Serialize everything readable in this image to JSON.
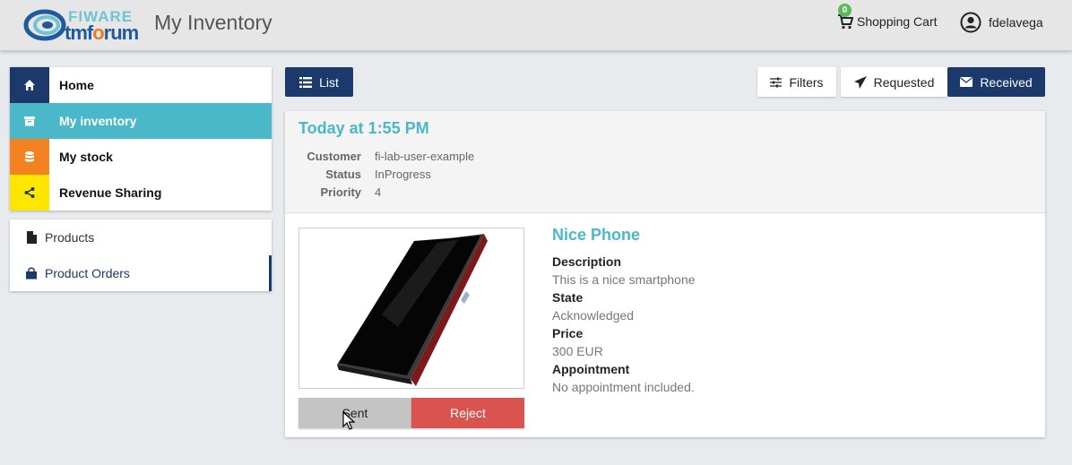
{
  "header": {
    "logo_top": "FIWARE",
    "logo_bottom_tm": "tm",
    "logo_bottom_f": "f",
    "logo_bottom_rest": "rum",
    "title": "My Inventory",
    "cart_label": "Shopping Cart",
    "cart_count": "0",
    "username": "fdelavega"
  },
  "sidebar": {
    "main": [
      {
        "label": "Home",
        "icon": "home-icon",
        "color": "#1b3a6b"
      },
      {
        "label": "My inventory",
        "icon": "archive-icon",
        "color": "#4ab8c8"
      },
      {
        "label": "My stock",
        "icon": "database-icon",
        "color": "#f58220"
      },
      {
        "label": "Revenue Sharing",
        "icon": "share-icon",
        "color": "#ffe600"
      }
    ],
    "sub": [
      {
        "label": "Products",
        "icon": "file-icon"
      },
      {
        "label": "Product Orders",
        "icon": "shopping-bag-icon"
      }
    ]
  },
  "toolbar": {
    "list_label": "List",
    "filters_label": "Filters",
    "requested_label": "Requested",
    "received_label": "Received"
  },
  "order": {
    "date": "Today at 1:55 PM",
    "meta": [
      {
        "key": "Customer",
        "value": "fi-lab-user-example"
      },
      {
        "key": "Status",
        "value": "InProgress"
      },
      {
        "key": "Priority",
        "value": "4"
      }
    ],
    "product": {
      "name": "Nice Phone",
      "description_label": "Description",
      "description": "This is a nice smartphone",
      "state_label": "State",
      "state": "Acknowledged",
      "price_label": "Price",
      "price": "300 EUR",
      "appointment_label": "Appointment",
      "appointment": "No appointment included."
    },
    "sent_label": "Sent",
    "reject_label": "Reject"
  },
  "colors": {
    "accent": "#4ab8c8",
    "primary": "#1b3a6b",
    "danger": "#d9534f",
    "badge": "#5cb85c"
  }
}
